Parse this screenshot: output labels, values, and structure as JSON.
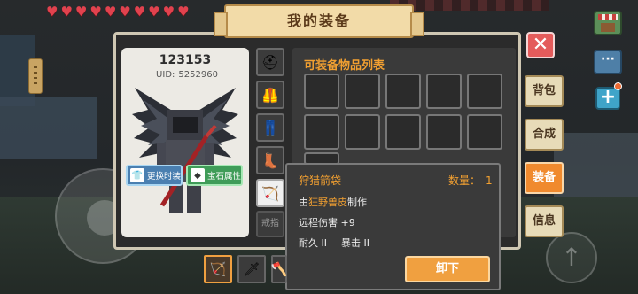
{
  "panel": {
    "title": "我的装备"
  },
  "player": {
    "name": "123153",
    "uid_label": "UID:",
    "uid": "5252960"
  },
  "buttons": {
    "change_skin": "更换时装",
    "gem_attributes": "宝石属性",
    "unequip": "卸下"
  },
  "equipment": {
    "slots": [
      {
        "icon": "helmet-icon"
      },
      {
        "icon": "chestplate-icon"
      },
      {
        "icon": "leggings-icon"
      },
      {
        "icon": "boots-icon"
      },
      {
        "icon": "quiver-icon",
        "selected": true
      }
    ],
    "ring_label": "戒指"
  },
  "inventory": {
    "title": "可装备物品列表"
  },
  "tabs": [
    {
      "label": "背包",
      "active": false
    },
    {
      "label": "合成",
      "active": false
    },
    {
      "label": "装备",
      "active": true
    },
    {
      "label": "信息",
      "active": false
    }
  ],
  "tooltip": {
    "item_name": "狩猎箭袋",
    "quantity_label": "数量：",
    "quantity": "1",
    "made_by_prefix": "由",
    "made_by_material": "狂野兽皮",
    "made_by_suffix": "制作",
    "ranged_damage": "远程伤害 +9",
    "durability": "耐久 II",
    "critical": "暴击 II"
  },
  "hotbar": [
    {
      "icon": "bow-icon",
      "selected": true
    },
    {
      "icon": "sword-icon",
      "selected": false
    },
    {
      "icon": "axe-icon",
      "selected": false
    }
  ],
  "hud": {
    "hearts": 10
  },
  "colors": {
    "accent": "#f0a040",
    "panel": "#2b2b2b",
    "close": "#e45b5b",
    "title_plate": "#f2dba8"
  }
}
